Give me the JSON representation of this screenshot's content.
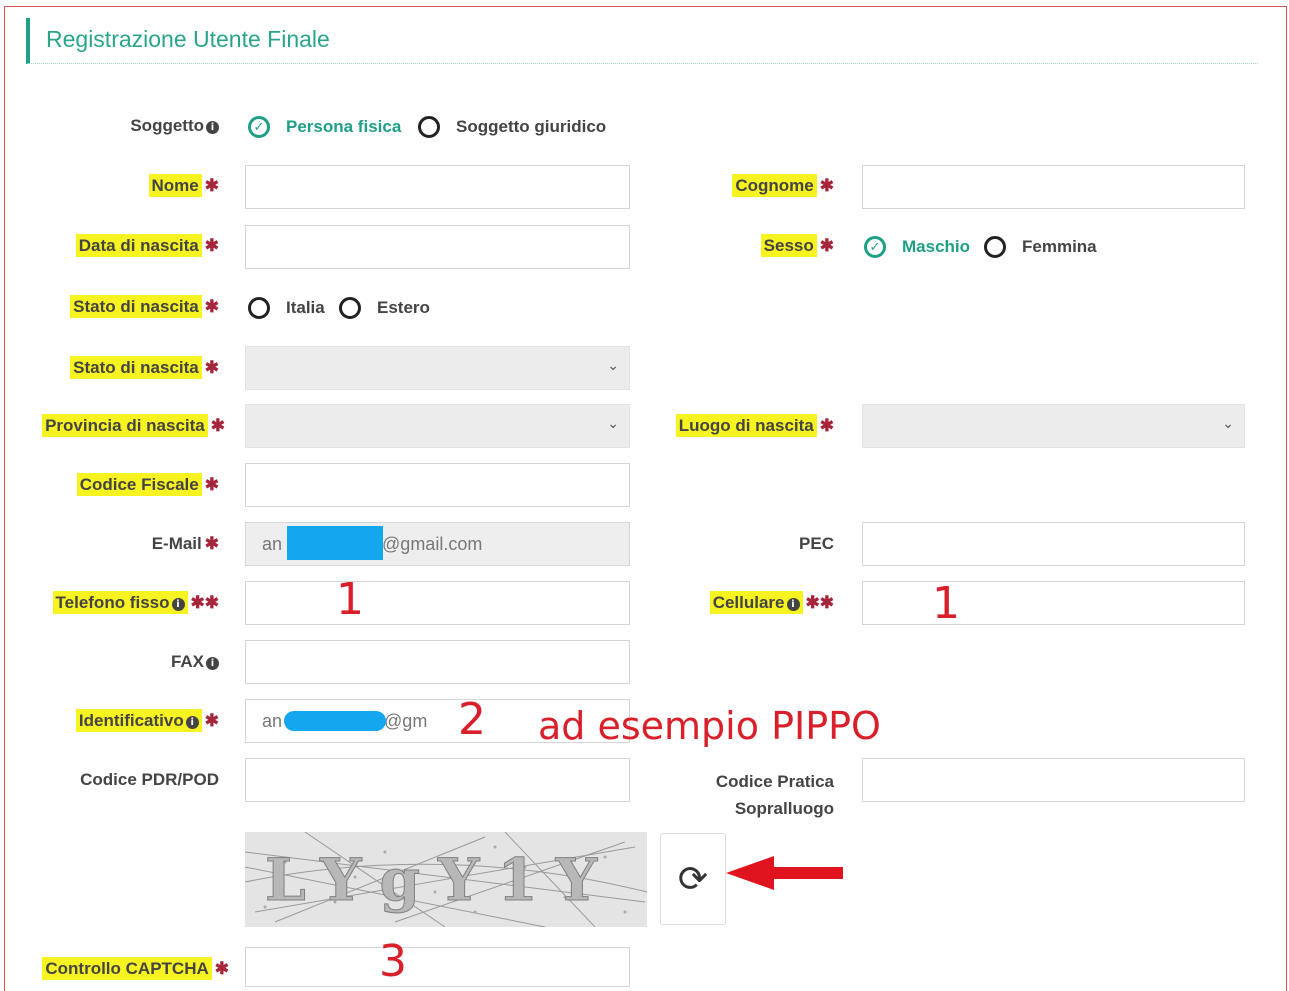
{
  "form": {
    "title": "Registrazione Utente Finale",
    "soggetto": {
      "label": "Soggetto",
      "options": [
        "Persona fisica",
        "Soggetto giuridico"
      ],
      "selected": "Persona fisica"
    },
    "nome": {
      "label": "Nome",
      "value": ""
    },
    "cognome": {
      "label": "Cognome",
      "value": ""
    },
    "data_nascita": {
      "label": "Data di nascita",
      "value": ""
    },
    "sesso": {
      "label": "Sesso",
      "options": [
        "Maschio",
        "Femmina"
      ],
      "selected": "Maschio"
    },
    "stato_nascita_radio": {
      "label": "Stato di nascita",
      "options": [
        "Italia",
        "Estero"
      ],
      "selected": ""
    },
    "stato_nascita_select": {
      "label": "Stato di nascita",
      "value": ""
    },
    "provincia": {
      "label": "Provincia di nascita",
      "value": ""
    },
    "luogo": {
      "label": "Luogo di nascita",
      "value": ""
    },
    "codice_fiscale": {
      "label": "Codice Fiscale",
      "value": ""
    },
    "email": {
      "label": "E-Mail",
      "value_start": "an",
      "value_end": "i@gmail.com"
    },
    "pec": {
      "label": "PEC",
      "value": ""
    },
    "telefono": {
      "label": "Telefono fisso",
      "value": ""
    },
    "cellulare": {
      "label": "Cellulare",
      "value": ""
    },
    "fax": {
      "label": "FAX",
      "value": ""
    },
    "identificativo": {
      "label": "Identificativo",
      "value_start": "an",
      "value_end": "@gm"
    },
    "pdr": {
      "label": "Codice PDR/POD",
      "value": ""
    },
    "pratica": {
      "label_line1": "Codice Pratica",
      "label_line2": "Sopralluogo",
      "value": ""
    },
    "captcha": {
      "label": "Controllo CAPTCHA",
      "image_text": "LYgY1Y",
      "value": ""
    }
  },
  "annotations": {
    "n1": "1",
    "n2": "2",
    "n3": "3",
    "example": "ad esempio PIPPO"
  },
  "colors": {
    "accent": "#1e9f86",
    "highlight": "#f7f320",
    "required": "#a6253a",
    "annotation": "#d81f2a"
  }
}
